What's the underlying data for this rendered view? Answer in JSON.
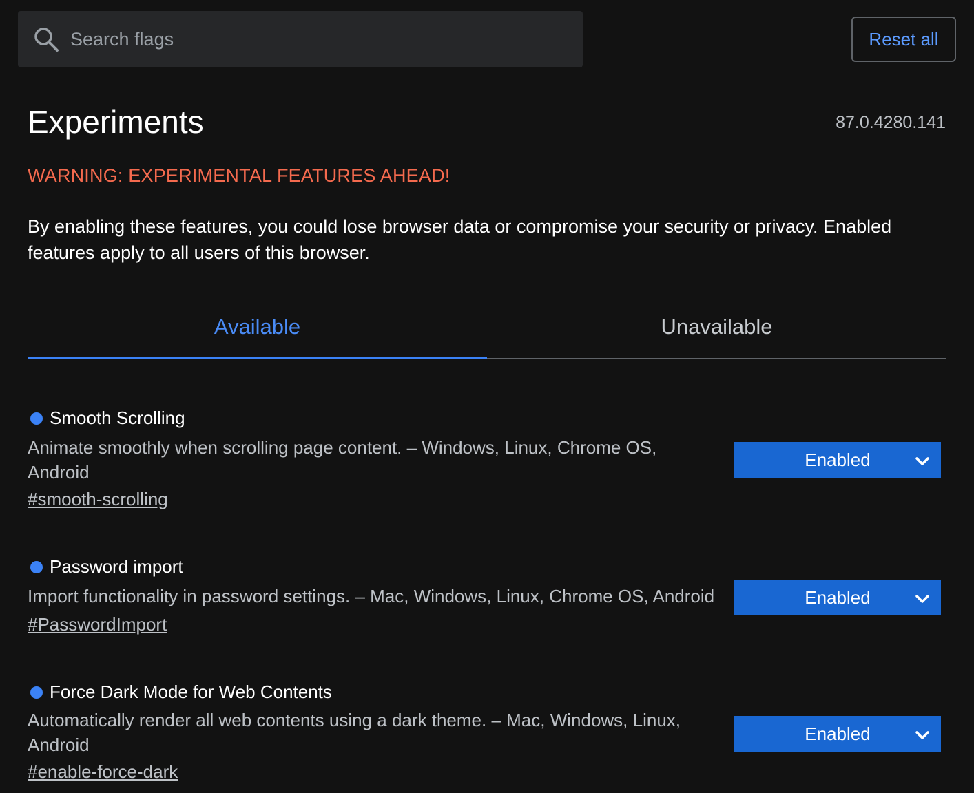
{
  "search": {
    "placeholder": "Search flags",
    "value": ""
  },
  "header": {
    "reset_label": "Reset all",
    "title": "Experiments",
    "version": "87.0.4280.141"
  },
  "warning": "WARNING: EXPERIMENTAL FEATURES AHEAD!",
  "description": "By enabling these features, you could lose browser data or compromise your security or privacy. Enabled features apply to all users of this browser.",
  "tabs": [
    {
      "label": "Available",
      "active": true
    },
    {
      "label": "Unavailable",
      "active": false
    }
  ],
  "flags": [
    {
      "title": "Smooth Scrolling",
      "description": "Animate smoothly when scrolling page content. – Windows, Linux, Chrome OS, Android",
      "link": "#smooth-scrolling",
      "state": "Enabled"
    },
    {
      "title": "Password import",
      "description": "Import functionality in password settings. – Mac, Windows, Linux, Chrome OS, Android",
      "link": "#PasswordImport",
      "state": "Enabled"
    },
    {
      "title": "Force Dark Mode for Web Contents",
      "description": "Automatically render all web contents using a dark theme. – Mac, Windows, Linux, Android",
      "link": "#enable-force-dark",
      "state": "Enabled"
    }
  ],
  "colors": {
    "background": "#121212",
    "accent": "#3b82f6",
    "warning": "#f46a4e",
    "select_bg": "#1967d2"
  }
}
